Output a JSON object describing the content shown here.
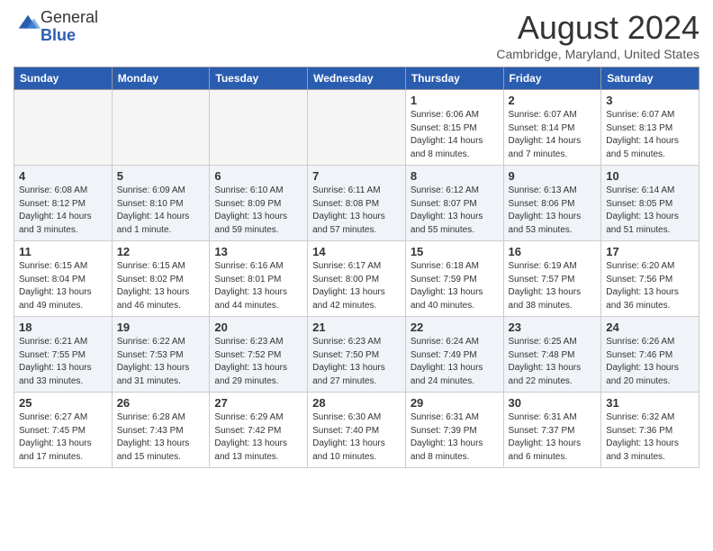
{
  "header": {
    "logo_general": "General",
    "logo_blue": "Blue",
    "month_year": "August 2024",
    "location": "Cambridge, Maryland, United States"
  },
  "days_of_week": [
    "Sunday",
    "Monday",
    "Tuesday",
    "Wednesday",
    "Thursday",
    "Friday",
    "Saturday"
  ],
  "weeks": [
    [
      {
        "day": "",
        "info": ""
      },
      {
        "day": "",
        "info": ""
      },
      {
        "day": "",
        "info": ""
      },
      {
        "day": "",
        "info": ""
      },
      {
        "day": "1",
        "info": "Sunrise: 6:06 AM\nSunset: 8:15 PM\nDaylight: 14 hours\nand 8 minutes."
      },
      {
        "day": "2",
        "info": "Sunrise: 6:07 AM\nSunset: 8:14 PM\nDaylight: 14 hours\nand 7 minutes."
      },
      {
        "day": "3",
        "info": "Sunrise: 6:07 AM\nSunset: 8:13 PM\nDaylight: 14 hours\nand 5 minutes."
      }
    ],
    [
      {
        "day": "4",
        "info": "Sunrise: 6:08 AM\nSunset: 8:12 PM\nDaylight: 14 hours\nand 3 minutes."
      },
      {
        "day": "5",
        "info": "Sunrise: 6:09 AM\nSunset: 8:10 PM\nDaylight: 14 hours\nand 1 minute."
      },
      {
        "day": "6",
        "info": "Sunrise: 6:10 AM\nSunset: 8:09 PM\nDaylight: 13 hours\nand 59 minutes."
      },
      {
        "day": "7",
        "info": "Sunrise: 6:11 AM\nSunset: 8:08 PM\nDaylight: 13 hours\nand 57 minutes."
      },
      {
        "day": "8",
        "info": "Sunrise: 6:12 AM\nSunset: 8:07 PM\nDaylight: 13 hours\nand 55 minutes."
      },
      {
        "day": "9",
        "info": "Sunrise: 6:13 AM\nSunset: 8:06 PM\nDaylight: 13 hours\nand 53 minutes."
      },
      {
        "day": "10",
        "info": "Sunrise: 6:14 AM\nSunset: 8:05 PM\nDaylight: 13 hours\nand 51 minutes."
      }
    ],
    [
      {
        "day": "11",
        "info": "Sunrise: 6:15 AM\nSunset: 8:04 PM\nDaylight: 13 hours\nand 49 minutes."
      },
      {
        "day": "12",
        "info": "Sunrise: 6:15 AM\nSunset: 8:02 PM\nDaylight: 13 hours\nand 46 minutes."
      },
      {
        "day": "13",
        "info": "Sunrise: 6:16 AM\nSunset: 8:01 PM\nDaylight: 13 hours\nand 44 minutes."
      },
      {
        "day": "14",
        "info": "Sunrise: 6:17 AM\nSunset: 8:00 PM\nDaylight: 13 hours\nand 42 minutes."
      },
      {
        "day": "15",
        "info": "Sunrise: 6:18 AM\nSunset: 7:59 PM\nDaylight: 13 hours\nand 40 minutes."
      },
      {
        "day": "16",
        "info": "Sunrise: 6:19 AM\nSunset: 7:57 PM\nDaylight: 13 hours\nand 38 minutes."
      },
      {
        "day": "17",
        "info": "Sunrise: 6:20 AM\nSunset: 7:56 PM\nDaylight: 13 hours\nand 36 minutes."
      }
    ],
    [
      {
        "day": "18",
        "info": "Sunrise: 6:21 AM\nSunset: 7:55 PM\nDaylight: 13 hours\nand 33 minutes."
      },
      {
        "day": "19",
        "info": "Sunrise: 6:22 AM\nSunset: 7:53 PM\nDaylight: 13 hours\nand 31 minutes."
      },
      {
        "day": "20",
        "info": "Sunrise: 6:23 AM\nSunset: 7:52 PM\nDaylight: 13 hours\nand 29 minutes."
      },
      {
        "day": "21",
        "info": "Sunrise: 6:23 AM\nSunset: 7:50 PM\nDaylight: 13 hours\nand 27 minutes."
      },
      {
        "day": "22",
        "info": "Sunrise: 6:24 AM\nSunset: 7:49 PM\nDaylight: 13 hours\nand 24 minutes."
      },
      {
        "day": "23",
        "info": "Sunrise: 6:25 AM\nSunset: 7:48 PM\nDaylight: 13 hours\nand 22 minutes."
      },
      {
        "day": "24",
        "info": "Sunrise: 6:26 AM\nSunset: 7:46 PM\nDaylight: 13 hours\nand 20 minutes."
      }
    ],
    [
      {
        "day": "25",
        "info": "Sunrise: 6:27 AM\nSunset: 7:45 PM\nDaylight: 13 hours\nand 17 minutes."
      },
      {
        "day": "26",
        "info": "Sunrise: 6:28 AM\nSunset: 7:43 PM\nDaylight: 13 hours\nand 15 minutes."
      },
      {
        "day": "27",
        "info": "Sunrise: 6:29 AM\nSunset: 7:42 PM\nDaylight: 13 hours\nand 13 minutes."
      },
      {
        "day": "28",
        "info": "Sunrise: 6:30 AM\nSunset: 7:40 PM\nDaylight: 13 hours\nand 10 minutes."
      },
      {
        "day": "29",
        "info": "Sunrise: 6:31 AM\nSunset: 7:39 PM\nDaylight: 13 hours\nand 8 minutes."
      },
      {
        "day": "30",
        "info": "Sunrise: 6:31 AM\nSunset: 7:37 PM\nDaylight: 13 hours\nand 6 minutes."
      },
      {
        "day": "31",
        "info": "Sunrise: 6:32 AM\nSunset: 7:36 PM\nDaylight: 13 hours\nand 3 minutes."
      }
    ]
  ]
}
